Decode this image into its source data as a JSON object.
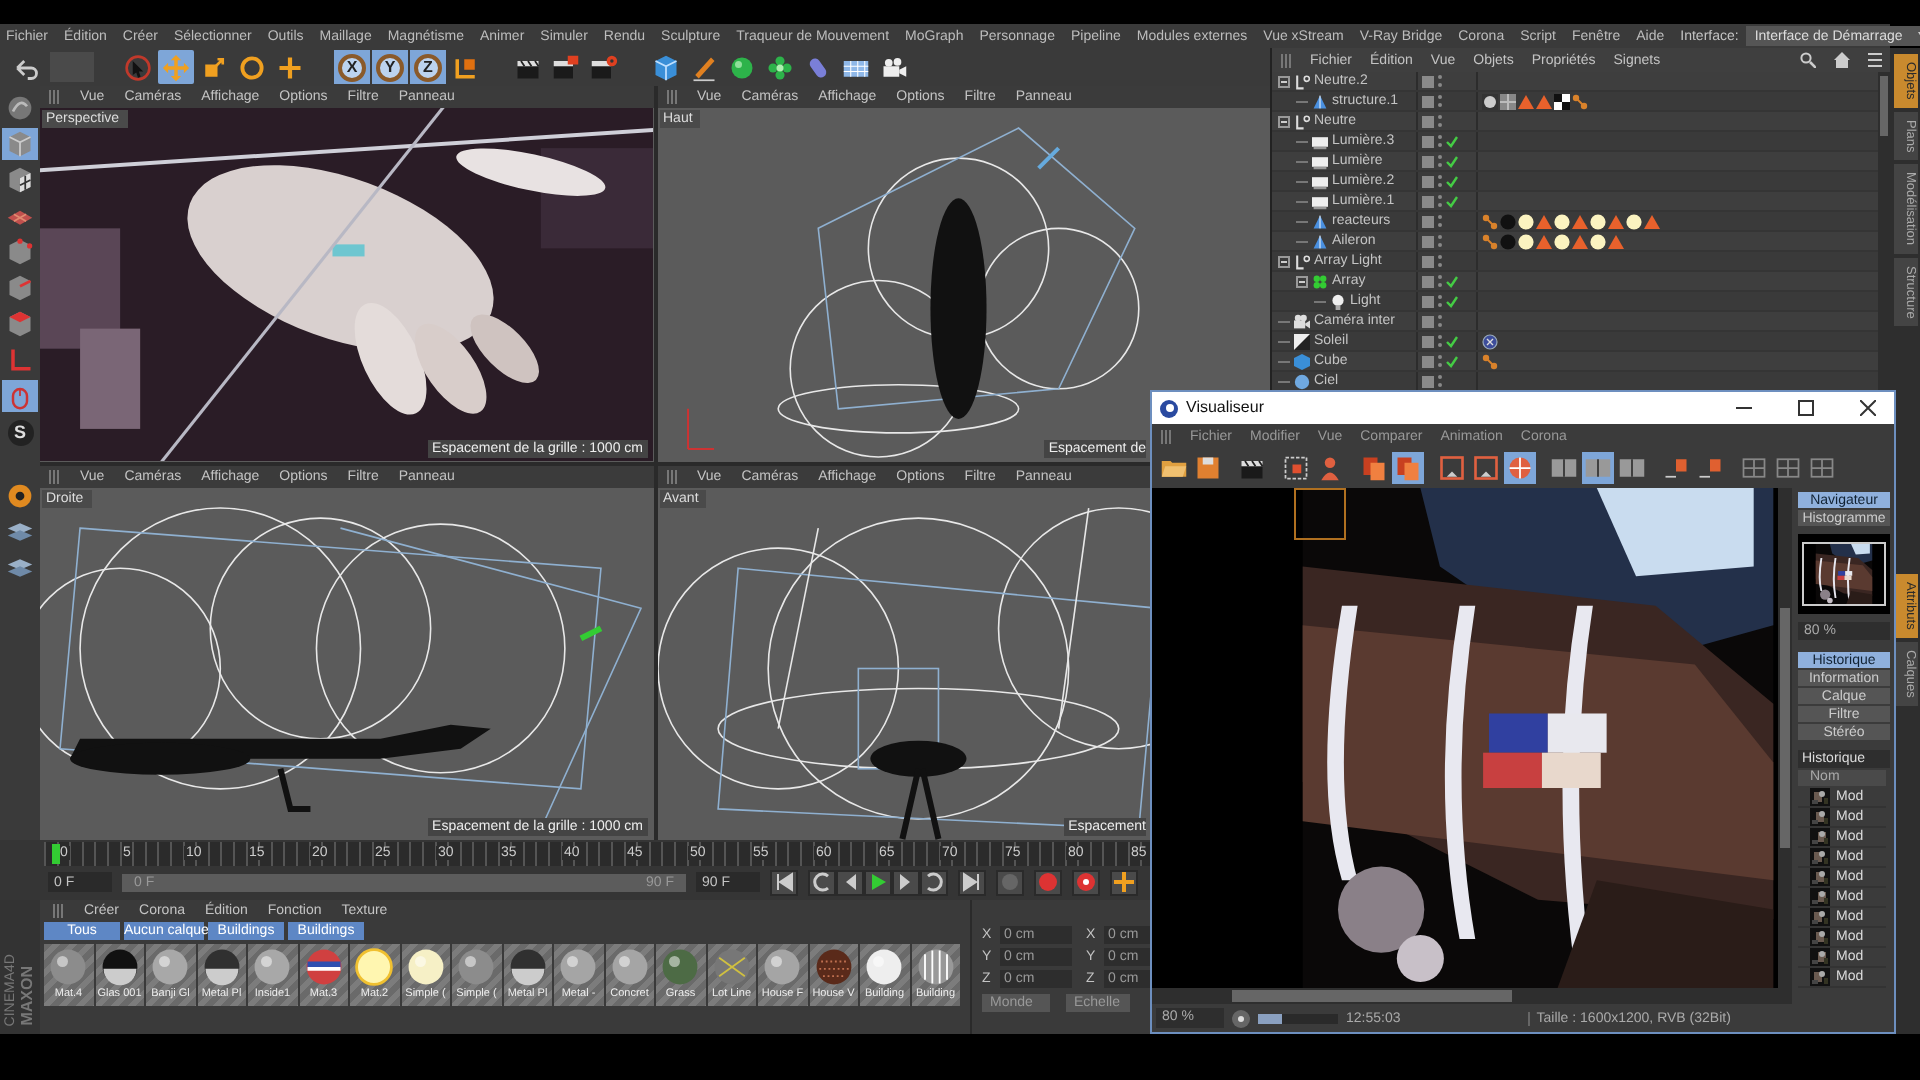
{
  "menu_bar": {
    "items": [
      "Fichier",
      "Édition",
      "Créer",
      "Sélectionner",
      "Outils",
      "Maillage",
      "Magnétisme",
      "Animer",
      "Simuler",
      "Rendu",
      "Sculpture",
      "Traqueur de Mouvement",
      "MoGraph",
      "Personnage",
      "Pipeline",
      "Modules externes",
      "Vue xStream",
      "V-Ray Bridge",
      "Corona",
      "Script",
      "Fenêtre",
      "Aide"
    ],
    "interface_label": "Interface:",
    "interface_value": "Interface de Démarrage"
  },
  "toolbar": {
    "tools": [
      {
        "kind": "icon",
        "selected": false
      },
      {
        "kind": "blank"
      },
      {
        "kind": "icon",
        "selected": false
      },
      {
        "kind": "icon",
        "selected": true
      },
      {
        "kind": "icon",
        "selected": false
      },
      {
        "kind": "icon",
        "selected": false
      },
      {
        "kind": "icon",
        "selected": false
      },
      {
        "kind": "axis",
        "label": "X",
        "selected": true
      },
      {
        "kind": "axis",
        "label": "Y",
        "selected": true
      },
      {
        "kind": "axis",
        "label": "Z",
        "selected": true
      },
      {
        "kind": "icon",
        "selected": false
      },
      {
        "kind": "icon",
        "selected": false
      },
      {
        "kind": "icon",
        "selected": false
      },
      {
        "kind": "icon",
        "selected": false
      },
      {
        "kind": "icon",
        "selected": false
      },
      {
        "kind": "icon",
        "selected": false
      },
      {
        "kind": "icon",
        "selected": false
      },
      {
        "kind": "icon",
        "selected": false
      },
      {
        "kind": "icon",
        "selected": false
      },
      {
        "kind": "icon",
        "selected": false
      },
      {
        "kind": "icon",
        "selected": false
      }
    ]
  },
  "left_tools": [
    {
      "kind": "icon",
      "selected": false
    },
    {
      "kind": "icon",
      "selected": true
    },
    {
      "kind": "icon",
      "selected": false
    },
    {
      "kind": "icon",
      "selected": false
    },
    {
      "kind": "icon",
      "selected": false
    },
    {
      "kind": "icon",
      "selected": false
    },
    {
      "kind": "icon",
      "selected": false
    },
    {
      "kind": "icon",
      "selected": false
    },
    {
      "kind": "icon",
      "selected": true
    },
    {
      "kind": "text",
      "label": "S",
      "selected": false
    },
    {
      "kind": "icon",
      "selected": false
    },
    {
      "kind": "icon",
      "selected": false
    },
    {
      "kind": "icon",
      "selected": false
    }
  ],
  "viewports": [
    {
      "kind": "picture",
      "menu": [
        "Vue",
        "Caméras",
        "Affichage",
        "Options",
        "Filtre",
        "Panneau"
      ],
      "name": "Perspective",
      "grid": "Espacement de la grille : 1000 cm"
    },
    {
      "kind": "wireframe",
      "menu": [
        "Vue",
        "Caméras",
        "Affichage",
        "Options",
        "Filtre",
        "Panneau"
      ],
      "name": "Haut",
      "grid": "Espacement de"
    },
    {
      "kind": "wireframe",
      "menu": [
        "Vue",
        "Caméras",
        "Affichage",
        "Options",
        "Filtre",
        "Panneau"
      ],
      "name": "Droite",
      "grid": "Espacement de la grille : 1000 cm"
    },
    {
      "kind": "wireframe",
      "menu": [
        "Vue",
        "Caméras",
        "Affichage",
        "Options",
        "Filtre",
        "Panneau"
      ],
      "name": "Avant",
      "grid": "Espacement"
    }
  ],
  "object_manager": {
    "menu": [
      "Fichier",
      "Édition",
      "Vue",
      "Objets",
      "Propriétés",
      "Signets"
    ],
    "objects": [
      {
        "name": "Neutre.2",
        "kind": "null",
        "enabled": false,
        "expanded": true,
        "children": [
          {
            "name": "structure.1",
            "kind": "mesh",
            "enabled": false
          }
        ]
      },
      {
        "name": "Neutre",
        "kind": "null",
        "enabled": false,
        "expanded": true,
        "children": [
          {
            "name": "Lumière.3",
            "kind": "light",
            "enabled": true
          },
          {
            "name": "Lumière",
            "kind": "light",
            "enabled": true
          },
          {
            "name": "Lumière.2",
            "kind": "light",
            "enabled": true
          },
          {
            "name": "Lumière.1",
            "kind": "light",
            "enabled": true
          },
          {
            "name": "reacteurs",
            "kind": "mesh",
            "enabled": false
          },
          {
            "name": "Aileron",
            "kind": "mesh",
            "enabled": false
          }
        ]
      },
      {
        "name": "Array Light",
        "kind": "null",
        "enabled": false,
        "expanded": true,
        "children": [
          {
            "name": "Array",
            "kind": "array",
            "enabled": true,
            "expanded": true,
            "children": [
              {
                "name": "Light",
                "kind": "bulb",
                "enabled": true
              }
            ]
          }
        ]
      },
      {
        "name": "Caméra inter",
        "kind": "camera",
        "enabled": false
      },
      {
        "name": "Soleil",
        "kind": "sun",
        "enabled": true
      },
      {
        "name": "Cube",
        "kind": "cube",
        "enabled": true
      },
      {
        "name": "Ciel",
        "kind": "sky",
        "enabled": false
      }
    ]
  },
  "side_tabs": [
    {
      "label": "Objets",
      "selected": true
    },
    {
      "label": "Plans",
      "selected": false
    },
    {
      "label": "Modélisation",
      "selected": false
    },
    {
      "label": "Structure",
      "selected": false
    }
  ],
  "lower_side_tabs": [
    {
      "label": "Attributs",
      "selected": true
    },
    {
      "label": "Calques",
      "selected": false
    }
  ],
  "timeline": {
    "ticks": [
      "0",
      "5",
      "10",
      "15",
      "20",
      "25",
      "30",
      "35",
      "40",
      "45",
      "50",
      "55",
      "60",
      "65",
      "70",
      "75",
      "80",
      "85"
    ],
    "current_frame": "0 F",
    "range_start": "0 F",
    "range_end": "90 F",
    "level": 1,
    "end_frame": "90 F"
  },
  "materials": {
    "logo": [
      "MAXON",
      "CINEMA4D"
    ],
    "menu": [
      "Créer",
      "Corona",
      "Édition",
      "Fonction",
      "Texture"
    ],
    "filters": [
      "Tous",
      "Aucun calque",
      "Buildings",
      "Buildings"
    ],
    "items": [
      {
        "name": "Mat.4",
        "kind": "stripe"
      },
      {
        "name": "Glas 001",
        "kind": "dark"
      },
      {
        "name": "Banji Gl",
        "kind": "glass"
      },
      {
        "name": "Metal Pl",
        "kind": "chrome"
      },
      {
        "name": "Inside1",
        "kind": "glass"
      },
      {
        "name": "Mat.3",
        "kind": "flag"
      },
      {
        "name": "Mat.2",
        "kind": "glow"
      },
      {
        "name": "Simple (",
        "kind": "cream"
      },
      {
        "name": "Simple (",
        "kind": "stripe"
      },
      {
        "name": "Metal Pl",
        "kind": "chrome"
      },
      {
        "name": "Metal -",
        "kind": "grey"
      },
      {
        "name": "Concret",
        "kind": "grey"
      },
      {
        "name": "Grass",
        "kind": "green"
      },
      {
        "name": "Lot Line",
        "kind": "tiled"
      },
      {
        "name": "House F",
        "kind": "grey"
      },
      {
        "name": "House V",
        "kind": "brick"
      },
      {
        "name": "Building",
        "kind": "white"
      },
      {
        "name": "Building",
        "kind": "wire"
      }
    ]
  },
  "coordinates": {
    "rows": [
      {
        "axis": "X",
        "value": "0 cm",
        "axis2": "X",
        "value2": "0 cm"
      },
      {
        "axis": "Y",
        "value": "0 cm",
        "axis2": "Y",
        "value2": "0 cm"
      },
      {
        "axis": "Z",
        "value": "0 cm",
        "axis2": "Z",
        "value2": "0 cm"
      }
    ],
    "mode": "Monde",
    "apply": "Echelle"
  },
  "viewer": {
    "title": "Visualiseur",
    "menu": [
      "Fichier",
      "Modifier",
      "Vue",
      "Comparer",
      "Animation",
      "Corona"
    ],
    "toolbar": [
      {
        "selected": false
      },
      {
        "selected": false
      },
      {
        "selected": false
      },
      {
        "selected": false
      },
      {
        "selected": false
      },
      {
        "selected": false
      },
      {
        "selected": true
      },
      {
        "selected": false
      },
      {
        "selected": false
      },
      {
        "selected": true
      },
      {
        "selected": false
      },
      {
        "selected": true
      },
      {
        "selected": false
      },
      {
        "selected": false
      },
      {
        "selected": false
      },
      {
        "selected": false
      },
      {
        "selected": false
      },
      {
        "selected": false
      }
    ],
    "tabs": [
      {
        "label": "Navigateur",
        "selected": true
      },
      {
        "label": "Histogramme",
        "selected": false
      }
    ],
    "zoom": "80 %",
    "info_tabs": [
      {
        "label": "Historique",
        "selected": true
      },
      {
        "label": "Information",
        "selected": false
      },
      {
        "label": "Calque",
        "selected": false
      },
      {
        "label": "Filtre",
        "selected": false
      },
      {
        "label": "Stéréo",
        "selected": false
      }
    ],
    "history_title": "Historique",
    "history_column": "Nom",
    "history_items": [
      "Mod",
      "Mod",
      "Mod",
      "Mod",
      "Mod",
      "Mod",
      "Mod",
      "Mod",
      "Mod",
      "Mod"
    ],
    "status": {
      "zoom": "80 %",
      "level": 0.3,
      "time": "12:55:03",
      "size": "Taille : 1600x1200, RVB (32Bit)"
    }
  }
}
